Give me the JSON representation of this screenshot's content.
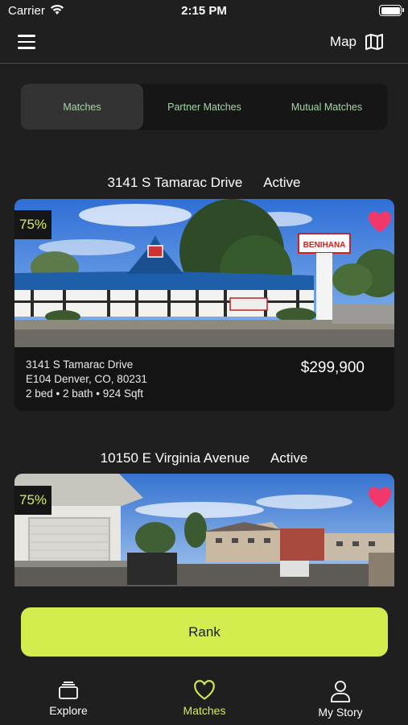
{
  "status_bar": {
    "carrier": "Carrier",
    "time": "2:15 PM"
  },
  "nav": {
    "map_label": "Map"
  },
  "segments": [
    {
      "label": "Matches",
      "active": true
    },
    {
      "label": "Partner Matches",
      "active": false
    },
    {
      "label": "Mutual Matches",
      "active": false
    }
  ],
  "listings": [
    {
      "title_address": "3141 S Tamarac Drive",
      "status": "Active",
      "match": "75%",
      "line1": "3141 S Tamarac Drive",
      "line2": "E104 Denver, CO, 80231",
      "line3": "2 bed • 2 bath • 924 Sqft",
      "price": "$299,900",
      "sign_text": "BENIHANA"
    },
    {
      "title_address": "10150 E Virginia Avenue",
      "status": "Active",
      "match": "75%"
    }
  ],
  "rank_button": "Rank",
  "tabs": [
    {
      "label": "Explore",
      "icon": "explore-icon"
    },
    {
      "label": "Matches",
      "icon": "heart-icon",
      "active": true
    },
    {
      "label": "My Story",
      "icon": "person-icon"
    }
  ],
  "colors": {
    "accent": "#d3ec4e",
    "heart": "#f2386b",
    "segment_text": "#a6d4a8",
    "background": "#1f1f1f"
  }
}
